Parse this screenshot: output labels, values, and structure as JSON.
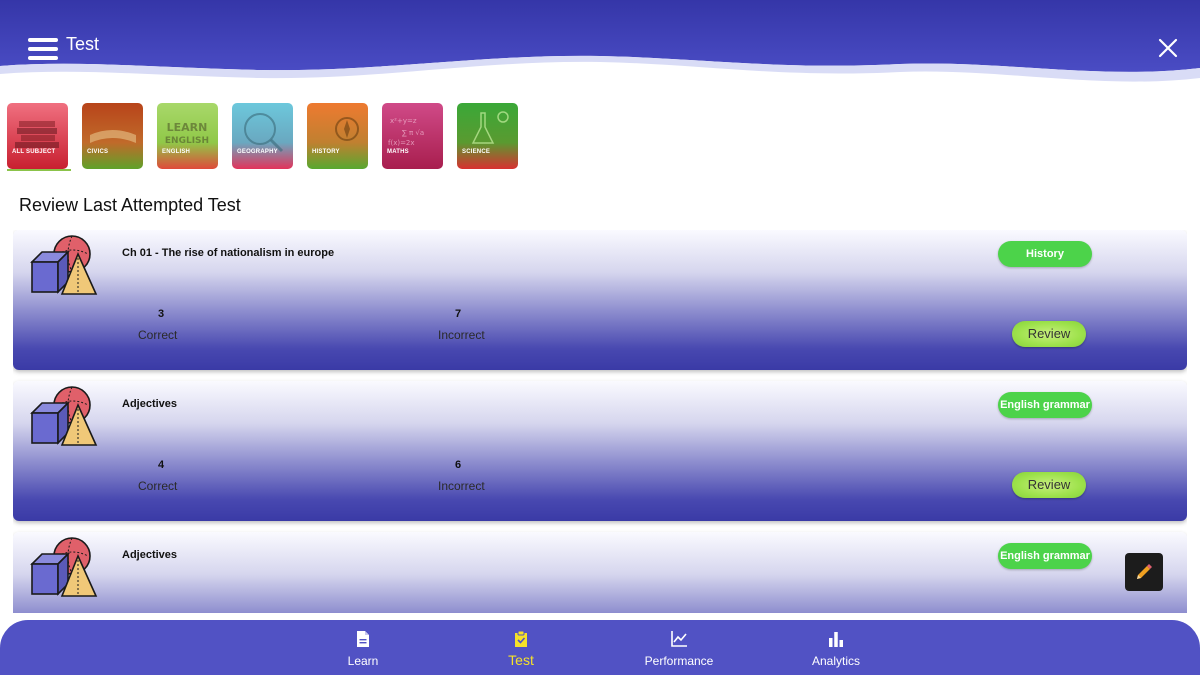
{
  "header": {
    "title": "Test"
  },
  "subjects": [
    {
      "label": "ALL SUBJECT",
      "color1": "#e84a5f",
      "color2": "#b8202f",
      "selected": true
    },
    {
      "label": "CIVICS",
      "color1": "#c8541c",
      "color2": "#6aa82a"
    },
    {
      "label": "ENGLISH",
      "color1": "#9ed04a",
      "color2": "#d9443a"
    },
    {
      "label": "GEOGRAPHY",
      "color1": "#5cc0d6",
      "color2": "#e0335b"
    },
    {
      "label": "HISTORY",
      "color1": "#e86a2a",
      "color2": "#5aa830"
    },
    {
      "label": "MATHS",
      "color1": "#c83a78",
      "color2": "#b02050"
    },
    {
      "label": "SCIENCE",
      "color1": "#3aa838",
      "color2": "#d8302c"
    }
  ],
  "section_title": "Review Last Attempted Test",
  "tests": [
    {
      "title": "Ch 01 - The rise of nationalism in europe",
      "subject": "History",
      "correct": "3",
      "incorrect": "7",
      "correct_label": "Correct",
      "incorrect_label": "Incorrect",
      "review_label": "Review"
    },
    {
      "title": "Adjectives",
      "subject": "English grammar",
      "correct": "4",
      "incorrect": "6",
      "correct_label": "Correct",
      "incorrect_label": "Incorrect",
      "review_label": "Review"
    },
    {
      "title": "Adjectives",
      "subject": "English grammar",
      "correct": "",
      "incorrect": "",
      "correct_label": "",
      "incorrect_label": "",
      "review_label": ""
    }
  ],
  "nav": [
    {
      "label": "Learn",
      "icon": "document-icon",
      "active": false
    },
    {
      "label": "Test",
      "icon": "clipboard-icon",
      "active": true
    },
    {
      "label": "Performance",
      "icon": "line-chart-icon",
      "active": false
    },
    {
      "label": "Analytics",
      "icon": "bar-chart-icon",
      "active": false
    }
  ],
  "colors": {
    "header": "#3b3db0",
    "nav": "#5152c4",
    "pill": "#4cd34a",
    "review": "#9ee24c",
    "active_nav": "#f5e12a"
  }
}
